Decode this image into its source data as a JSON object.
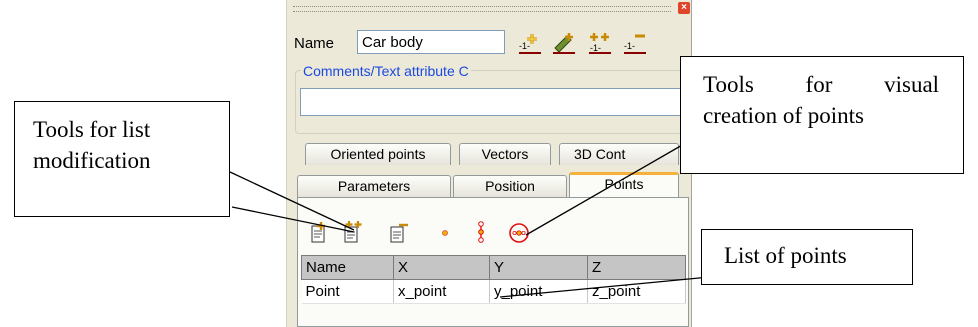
{
  "dialog": {
    "name_label": "Name",
    "name_value": "Car body",
    "comments_title": "Comments/Text attribute C",
    "comments_value": "",
    "tabs_row1": [
      "Oriented points",
      "Vectors",
      "3D Cont"
    ],
    "tabs_row2": [
      "Parameters",
      "Position",
      "Points"
    ],
    "active_tab": "Points",
    "top_tools": [
      "add-item-icon",
      "edit-item-icon",
      "insert-item-icon",
      "remove-item-icon"
    ],
    "list_tools": [
      "add-point-icon",
      "add-multiple-points-icon",
      "delete-point-icon"
    ],
    "visual_tools": [
      "single-point-icon",
      "point-chain-icon",
      "circle-points-icon"
    ],
    "colors": {
      "panel_bg": "#ECE9D8",
      "tab_accent": "#F4B13C",
      "group_title": "#1B4AE0",
      "close": "#E0442A"
    }
  },
  "points_table": {
    "columns": [
      "Name",
      "X",
      "Y",
      "Z"
    ],
    "rows": [
      [
        "Point",
        "x_point",
        "y_point",
        "z_point"
      ]
    ]
  },
  "callouts": {
    "list_modification": [
      "Tools for list",
      "modification"
    ],
    "visual_creation": [
      "Tools for visual",
      "creation of points"
    ],
    "list_of_points": "List of points"
  }
}
